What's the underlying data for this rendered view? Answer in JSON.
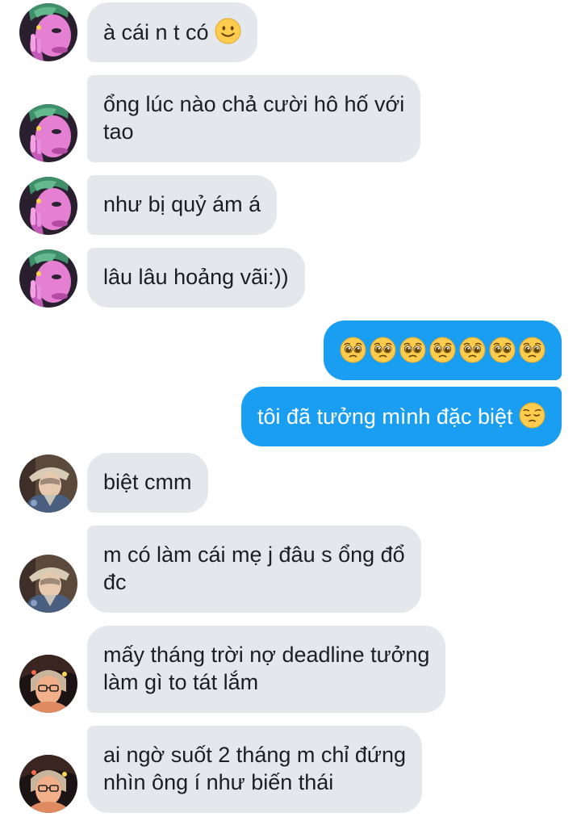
{
  "colors": {
    "incoming_bubble": "#e4e7eb",
    "outgoing_bubble": "#1a9ef2",
    "incoming_text": "#1c1e21",
    "outgoing_text": "#ffffff"
  },
  "messages": [
    {
      "sender": "contact-1",
      "direction": "incoming",
      "text": "à cái n t có",
      "emoji": "slightly-smiling-face"
    },
    {
      "sender": "contact-1",
      "direction": "incoming",
      "lines": [
        "ổng lúc nào chả cười hô hố với",
        "tao"
      ]
    },
    {
      "sender": "contact-1",
      "direction": "incoming",
      "text": "như bị quỷ ám á"
    },
    {
      "sender": "contact-1",
      "direction": "incoming",
      "text": "lâu lâu hoảng vãi:))"
    },
    {
      "sender": "me",
      "direction": "outgoing",
      "emoji_count": 7,
      "emoji": "pleading-face"
    },
    {
      "sender": "me",
      "direction": "outgoing",
      "text": "tôi đã tưởng mình đặc biệt",
      "emoji": "pensive-face"
    },
    {
      "sender": "contact-2",
      "direction": "incoming",
      "text": "biệt cmm"
    },
    {
      "sender": "contact-2",
      "direction": "incoming",
      "lines": [
        "m có làm cái mẹ j đâu s ổng đổ",
        "đc"
      ]
    },
    {
      "sender": "contact-3",
      "direction": "incoming",
      "lines": [
        "mấy tháng trời nợ deadline tưởng",
        "làm gì to tát lắm"
      ]
    },
    {
      "sender": "contact-3",
      "direction": "incoming",
      "lines": [
        "ai ngờ suốt 2 tháng m chỉ đứng",
        "nhìn ông í như biến thái"
      ]
    }
  ]
}
